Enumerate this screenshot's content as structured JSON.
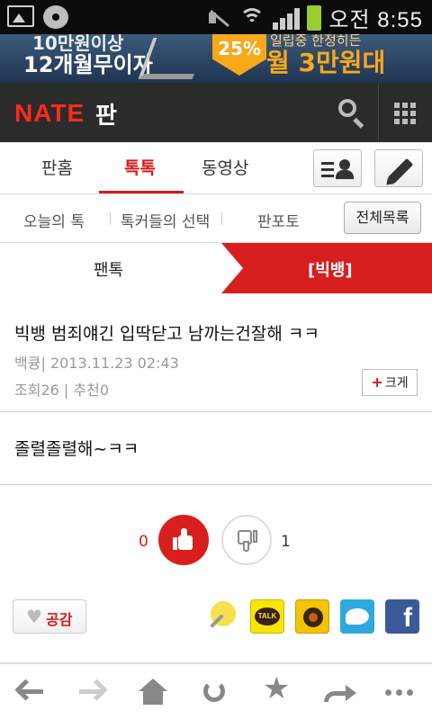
{
  "status_bar": {
    "time": "오전 8:55"
  },
  "ad": {
    "line1": "10만원이상",
    "line2": "12개월무이자",
    "badge": "25%",
    "line3": "일립중 한정히든",
    "line4": "월 3만원대"
  },
  "header": {
    "brand": "NATE",
    "section": "판"
  },
  "tabs": {
    "items": [
      "판홈",
      "톡톡",
      "동영상"
    ],
    "active": "톡톡"
  },
  "subtabs": {
    "items": [
      "오늘의 톡",
      "톡커들의 선택",
      "판포토"
    ],
    "all_button": "전체목록"
  },
  "arrow_tabs": {
    "left": "팬톡",
    "right": "[빅뱅]"
  },
  "post": {
    "title": "빅뱅 범죄얘긴 입딱닫고 남까는건잘해 ㅋㅋ",
    "author": "백큥",
    "date": "2013.11.23 02:43",
    "views": "조회26",
    "recommend": "추천0",
    "bigger_button": "크게",
    "body": "졸렬졸렬해~ㅋㅋ"
  },
  "votes": {
    "up": "0",
    "down": "1"
  },
  "share": {
    "like_label": "공감",
    "kakao_label": "TALK",
    "facebook_label": "f"
  },
  "colors": {
    "accent": "#d51a1a",
    "header_bg": "#2b2b2b"
  },
  "icons": [
    "back-icon",
    "forward-icon",
    "home-icon",
    "refresh-icon",
    "star-icon",
    "share-icon",
    "more-icon"
  ]
}
